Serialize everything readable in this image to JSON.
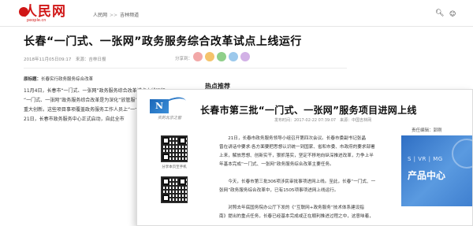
{
  "back_page": {
    "logo_text": "人民网",
    "logo_sub": "people.cn",
    "breadcrumbs": [
      "人民网",
      "吉林频道"
    ],
    "title": "长春“一门式、一张网”政务服务综合改革试点上线运行",
    "meta": "2018年11月05日09:17　来源：吉林日报",
    "share_label": "分享到：",
    "summary_label": "原标题：",
    "summary_text": "长春实行政务服务综合改革",
    "paragraphs": [
      "11月4日，长春市“一门式、一张网”政务服务综合改革试点上线运行，",
      "“一门式、一张网”政务服务综合改革是为深化“放管服”改革，推进",
      "重大创新。这些项目事项覆盖政务服务工作人员上“一个窗",
      "21日，长春市政务服务中心正式启动，自此全市"
    ],
    "hot_title": "热点推荐",
    "share_colors": [
      "#f2a8a8",
      "#f5c36b",
      "#8fcf8a",
      "#9cc9ec",
      "#d2b1e6"
    ]
  },
  "front_page": {
    "logo_letter": "N",
    "logo_slogan": "实的北京之窗",
    "title": "长春市第三批“一门式、一张网”服务项目进网上线",
    "meta": "发布时间：2017-02-22 07:39:07　来源：中国吉林网",
    "editor": "责任编辑：郭刚",
    "qr_labels": [
      "分享本页至手机",
      ""
    ],
    "paragraphs": [
      "　　21日，长春市政务服务领导小组召开第四次会议。长春市委副书记张晶",
      "曾在讲话中要求:各方面要把思想认识统一到国家、省和市委、市政府的要求部署",
      "上来，解放思想、创新实干，狠抓落实，坚定不移地向纵深推进改革，力争上半",
      "年基本完成“一门式、一张网”政务服务综合改革主要任务。",
      "",
      "　　今天，长春市第三批306项涉民审批事项进网上线。至此，长春“一门式、一",
      "张网”政务服务综合改革中，已有1505项事项进网上线运行。",
      "",
      "　　对照去年底国务院办公厅下发的《“互联网+政务服务”技术体系建设指",
      "南》提出的重点任务，长春已经基本完成或正在顺利推进过程之中，这意味着，"
    ],
    "promo_top": "S | VR | MG",
    "promo_main": "产品中心"
  }
}
